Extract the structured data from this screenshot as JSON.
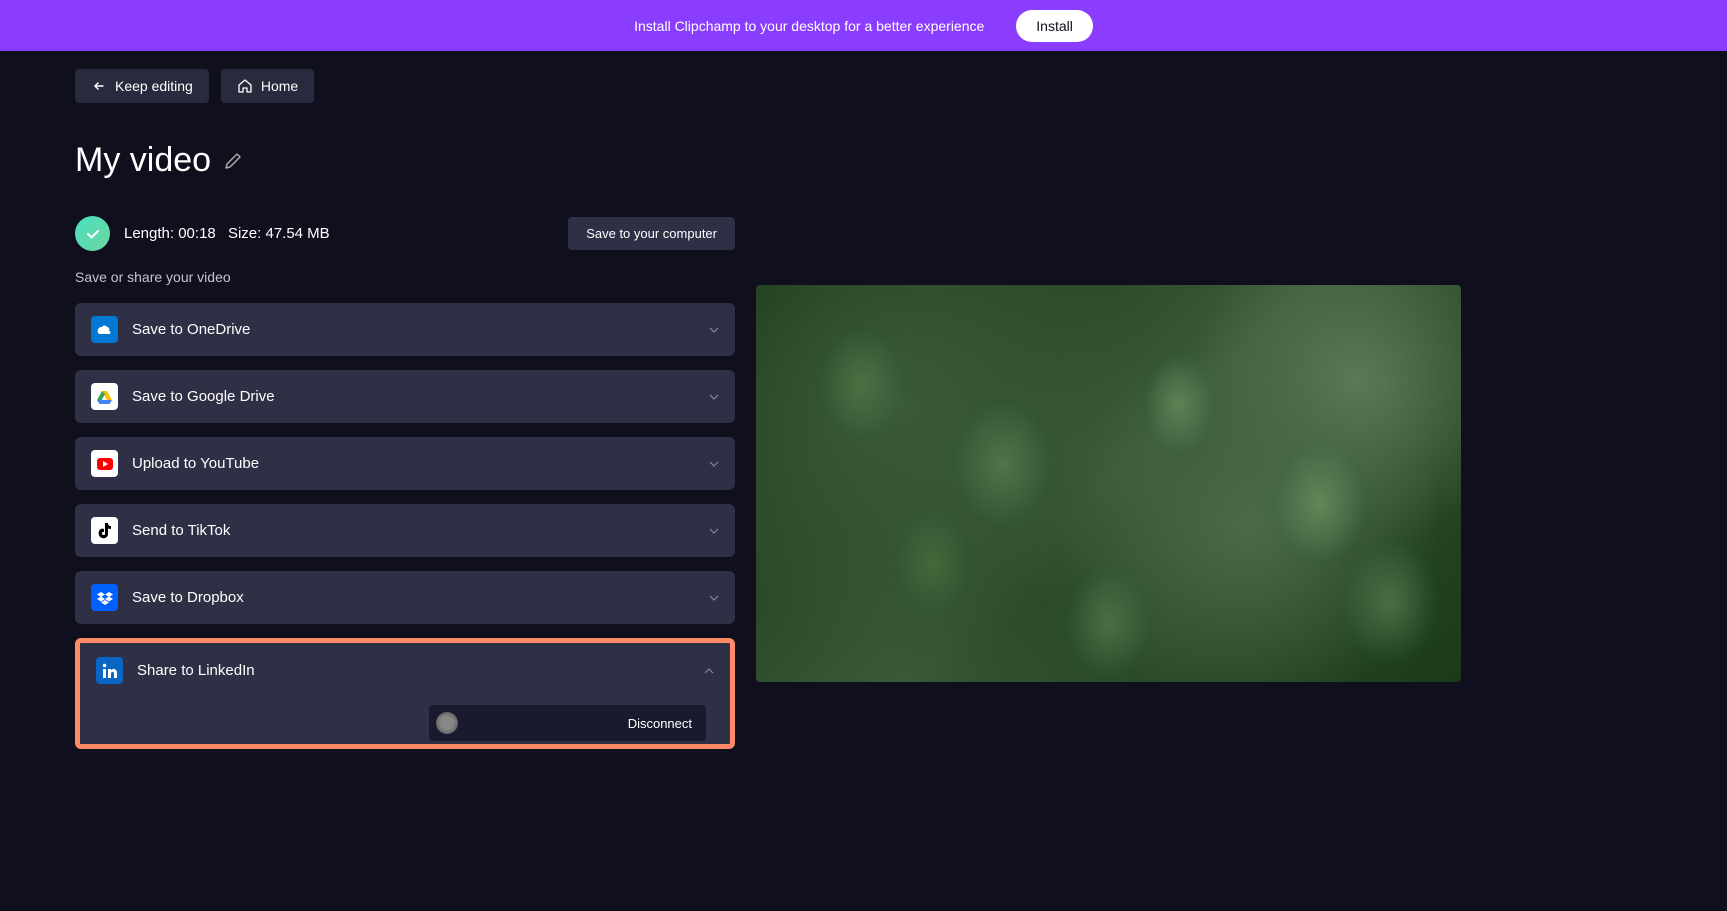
{
  "banner": {
    "text": "Install Clipchamp to your desktop for a better experience",
    "button": "Install"
  },
  "nav": {
    "keep_editing": "Keep editing",
    "home": "Home"
  },
  "title": "My video",
  "status": {
    "length_label": "Length:",
    "length_value": "00:18",
    "size_label": "Size:",
    "size_value": "47.54 MB"
  },
  "save_computer": "Save to your computer",
  "share_subtitle": "Save or share your video",
  "share_options": {
    "onedrive": "Save to OneDrive",
    "googledrive": "Save to Google Drive",
    "youtube": "Upload to YouTube",
    "tiktok": "Send to TikTok",
    "dropbox": "Save to Dropbox",
    "linkedin": "Share to LinkedIn"
  },
  "linkedin": {
    "disconnect": "Disconnect"
  }
}
